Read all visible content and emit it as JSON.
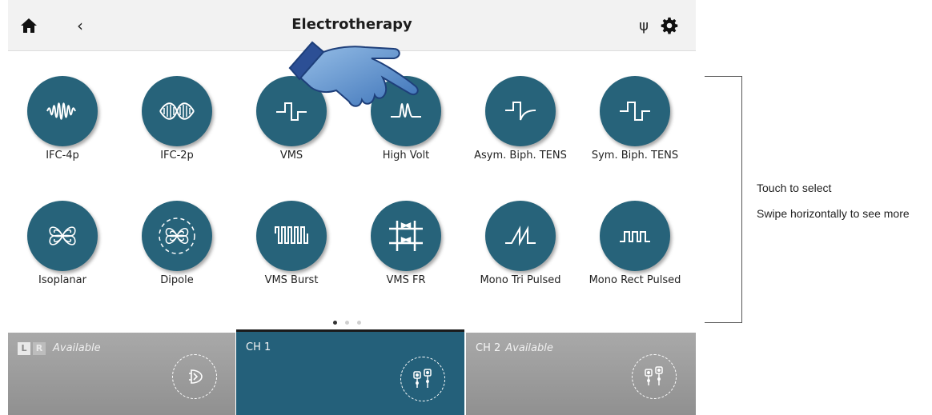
{
  "header": {
    "title": "Electrotherapy",
    "home_icon": "home-icon",
    "back_symbol": "‹",
    "usb_symbol": "ψ",
    "settings_icon": "gear-icon"
  },
  "programs": [
    {
      "label": "IFC-4p",
      "icon": "ifc-4p-icon"
    },
    {
      "label": "IFC-2p",
      "icon": "ifc-2p-icon"
    },
    {
      "label": "VMS",
      "icon": "vms-icon"
    },
    {
      "label": "High Volt",
      "icon": "high-volt-icon"
    },
    {
      "label": "Asym. Biph. TENS",
      "icon": "asym-biph-tens-icon"
    },
    {
      "label": "Sym. Biph. TENS",
      "icon": "sym-biph-tens-icon"
    },
    {
      "label": "Isoplanar",
      "icon": "isoplanar-icon"
    },
    {
      "label": "Dipole",
      "icon": "dipole-icon"
    },
    {
      "label": "VMS Burst",
      "icon": "vms-burst-icon"
    },
    {
      "label": "VMS FR",
      "icon": "vms-fr-icon"
    },
    {
      "label": "Mono Tri Pulsed",
      "icon": "mono-tri-pulsed-icon"
    },
    {
      "label": "Mono Rect Pulsed",
      "icon": "mono-rect-pulsed-icon"
    }
  ],
  "pager": {
    "pages": 3,
    "current": 1
  },
  "channels": {
    "lr": {
      "l": "L",
      "r": "R",
      "status": "Available",
      "icon": "ultrasound-head-icon"
    },
    "ch1": {
      "name": "CH 1",
      "icon": "electrodes-icon"
    },
    "ch2": {
      "name": "CH 2",
      "status": "Available",
      "icon": "electrodes-icon"
    }
  },
  "help": {
    "line1": "Touch to select",
    "line2": "Swipe horizontally to see more"
  },
  "colors": {
    "accent": "#27637a",
    "channel_active": "#24607a",
    "channel_inactive": "#9d9d9d",
    "topbar": "#f2f2f2"
  }
}
